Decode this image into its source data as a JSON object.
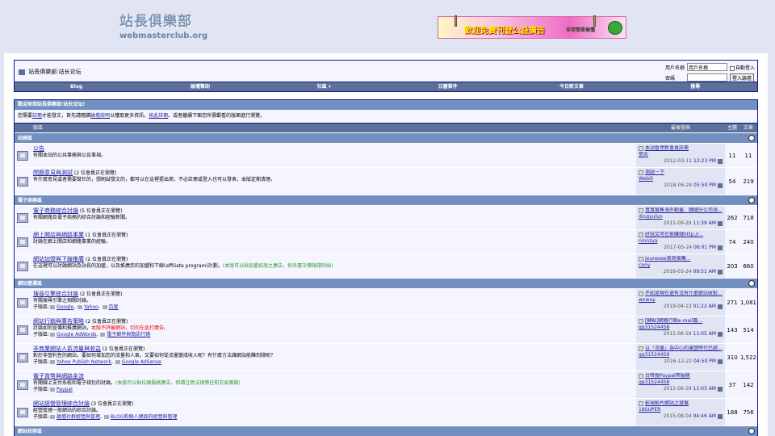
{
  "site": {
    "logo_cn": "站長俱樂部",
    "logo_en": "webmasterclub.org"
  },
  "banner": {
    "text": "歡迎免費刊登公益廣告",
    "sub": "非常簡單搞懂"
  },
  "nav": {
    "breadcrumb1": "站長俱樂部",
    "breadcrumb2": "站长论坛"
  },
  "login": {
    "user_label": "用戶名稱",
    "user_placeholder": "用戶名稱",
    "pass_label": "密碼",
    "remember": "自動登入",
    "button": "登入論壇"
  },
  "menu": [
    "Blog",
    "論壇幫助",
    "社區 ▾",
    "日曆事件",
    "今日新文章",
    "搜尋"
  ],
  "welcome": "歡迎來到站長俱樂部:站长论坛!",
  "notice": {
    "p1": "您需要",
    "link1": "註冊",
    "p2": "才能發文，首先請閱讀",
    "link2": "論壇說明",
    "p3": "以獲取更多資訊，",
    "link3": "按此註冊",
    "p4": "。或者繼續下面您所需觀看的版面進行瀏覽。"
  },
  "thead": {
    "forum": "版區",
    "last": "最後發表",
    "threads": "主題",
    "posts": "文章"
  },
  "sections": [
    {
      "title": "站務區",
      "forums": [
        {
          "title": "公告",
          "viewers": "",
          "desc": "有關本站的公共事務與公告事項。",
          "red": "",
          "green": "",
          "subs": [],
          "last": "本站暫停新會員註冊",
          "by": "張炎",
          "date": "2012-03-11",
          "time": "12:23 PM",
          "threads": "11",
          "posts": "11"
        },
        {
          "title": "問題意見與測試",
          "viewers": "(2 位會員正在瀏覽)",
          "desc": "有什麼意見或者需要幫忙的，想刷試發文的，都可以在這裡提出來，不必註冊或登入也可以發表，本版定期清理。",
          "red": "",
          "green": "",
          "subs": [],
          "last": "測試一下",
          "by": "Webili",
          "date": "2018-06-24",
          "time": "05:50 PM",
          "threads": "54",
          "posts": "219"
        }
      ]
    },
    {
      "title": "電子商務區",
      "forums": [
        {
          "title": "電子商務綜合討論",
          "viewers": "(5 位會員正在瀏覽)",
          "desc": "有關網路及電子商務的綜合討論和經驗新聞。",
          "red": "",
          "green": "",
          "subs": [],
          "last": "寬寬展售海外動畫、韓國分公司海...",
          "by": "dingyulun",
          "date": "2011-09-29",
          "time": "11:39 AM",
          "threads": "262",
          "posts": "718"
        },
        {
          "title": "網上開店與網路事業",
          "viewers": "(1 位會員正在瀏覽)",
          "desc": "討論在網上開店和網路事業的經驗。",
          "red": "",
          "green": "",
          "subs": [],
          "last": "好玩又可在家賺錢http://...",
          "by": "ninnzya",
          "date": "2017-05-24",
          "time": "06:01 PM",
          "threads": "74",
          "posts": "240"
        },
        {
          "title": "網站加盟與下線推廣",
          "viewers": "(2 位會員正在瀏覽)",
          "desc": "在這裡可以討論網站及站長的加盟，以及推廣您的加盟和下線(affiliate program)計劃。",
          "red": "",
          "green": "(本版可以貼加盟招商之廣告，但多層次傳銷請勿貼)",
          "subs": [],
          "last": "Jeunesse美商推薦...",
          "by": "cony",
          "date": "2016-03-24",
          "time": "09:51 AM",
          "threads": "203",
          "posts": "660"
        }
      ]
    },
    {
      "title": "網站營運區",
      "forums": [
        {
          "title": "搜尋引擎綜合討論",
          "viewers": "(2 位會員正在瀏覽)",
          "desc": "有關搜尋引擎之相關討論。",
          "red": "",
          "green": "",
          "subs": [
            "Google",
            "Yahoo",
            "百度"
          ],
          "last": "不知道現在還有沒有什麼網站收對...",
          "by": "wowuy",
          "date": "2019-04-13",
          "time": "01:22 AM",
          "threads": "271",
          "posts": "1,081"
        },
        {
          "title": "網站行銷與廣告策略",
          "viewers": "(2 位會員正在瀏覽)",
          "desc": "討論如何宣傳和推廣網站，",
          "red": "本版不評審網站，切勿在此打廣告。",
          "green": "",
          "subs": [
            "Google AdWords",
            "電子郵件與簡訊行銷"
          ],
          "last": "[轉貼]網路行銷e-mail篇...",
          "by": "qq31524458",
          "date": "2011-06-19",
          "time": "11:05 AM",
          "threads": "143",
          "posts": "514"
        },
        {
          "title": "非商業網站人氣流量與收益",
          "viewers": "(2 位會員正在瀏覽)",
          "desc": "對於非營利性的網站，要如何增加您的流量和人氣，又要如何從流量變成收入呢？有什麼方法讓網站能賺到錢呢？",
          "red": "",
          "green": "",
          "subs": [
            "Yahoo Publish Network",
            "Google AdSense"
          ],
          "last": "以「流量」為中心的運營時代已經...",
          "by": "qq31524458",
          "date": "2016-12-22",
          "time": "04:50 PM",
          "threads": "310",
          "posts": "1,522"
        },
        {
          "title": "電子貨幣與網路金流",
          "viewers": "",
          "desc": "有關線上支付系統和電子錢包的討論。",
          "red": "",
          "green": "(本版可以貼拉線服務廣告，但請注意法律責任和交易風險)",
          "subs": [
            "Paypal"
          ],
          "last": "台幣換Paypal幣服務",
          "by": "qq31524458",
          "date": "2011-06-19",
          "time": "11:03 AM",
          "threads": "37",
          "posts": "142"
        },
        {
          "title": "網站經營管理綜合討論",
          "viewers": "(3 位會員正在瀏覽)",
          "desc": "經營管理一般網站的綜合討論。",
          "red": "",
          "green": "",
          "subs": [
            "論壇社群經營與管理",
            "BLOG和個人網頁的經營與管理"
          ],
          "last": "影視影片網站之發展",
          "by": "18SUPER",
          "date": "2015-08-04",
          "time": "04:46 AM",
          "threads": "188",
          "posts": "756"
        }
      ]
    },
    {
      "title": "網站技術區",
      "forums": []
    }
  ]
}
